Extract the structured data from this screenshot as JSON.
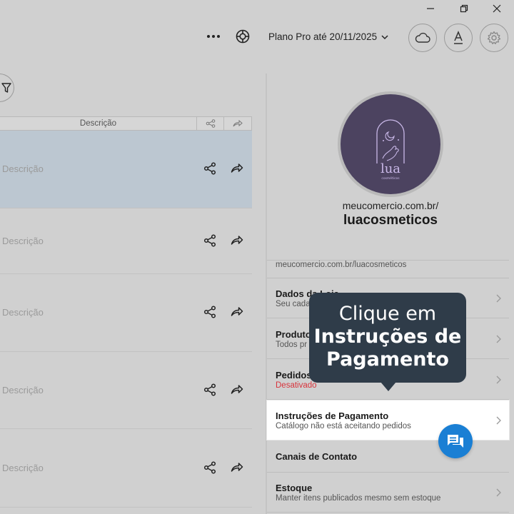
{
  "window": {
    "minimize_icon": "minimize-icon",
    "restore_icon": "restore-icon",
    "close_icon": "close-icon"
  },
  "topbar": {
    "plan_label": "Plano Pro até 20/11/2025",
    "icons": [
      "more-icon",
      "help-icon",
      "cloud-icon",
      "font-icon",
      "gear-icon"
    ]
  },
  "table": {
    "header_description": "Descrição",
    "rows": [
      {
        "description": "Descrição",
        "selected": true
      },
      {
        "description": "Descrição",
        "selected": false
      },
      {
        "description": "Descrição",
        "selected": false
      },
      {
        "description": "Descrição",
        "selected": false
      },
      {
        "description": "Descrição",
        "selected": false
      }
    ]
  },
  "store": {
    "logo_text": "lua",
    "logo_subtext": "cosméticos",
    "url_prefix": "meucomercio.com.br/",
    "name": "luacosmeticos",
    "full_url": "meucomercio.com.br/luacosmeticos"
  },
  "menu": [
    {
      "title": "Dados da Loja",
      "subtitle": "Seu cada"
    },
    {
      "title": "Produtos",
      "subtitle": "Todos pr"
    },
    {
      "title": "Pedidos",
      "subtitle": "Desativado"
    },
    {
      "title": "Instruções de Pagamento",
      "subtitle": "Catálogo não está aceitando pedidos"
    },
    {
      "title": "Canais de Contato",
      "subtitle": ""
    },
    {
      "title": "Estoque",
      "subtitle": "Manter itens publicados mesmo sem estoque"
    }
  ],
  "tooltip": {
    "line1": "Clique em",
    "line2": "Instruções de",
    "line3": "Pagamento"
  },
  "colors": {
    "selected_row": "#bcc7d1",
    "tooltip_bg": "#2f3c49",
    "chat_button": "#1a7fd4",
    "disabled_text": "#d8333b"
  }
}
